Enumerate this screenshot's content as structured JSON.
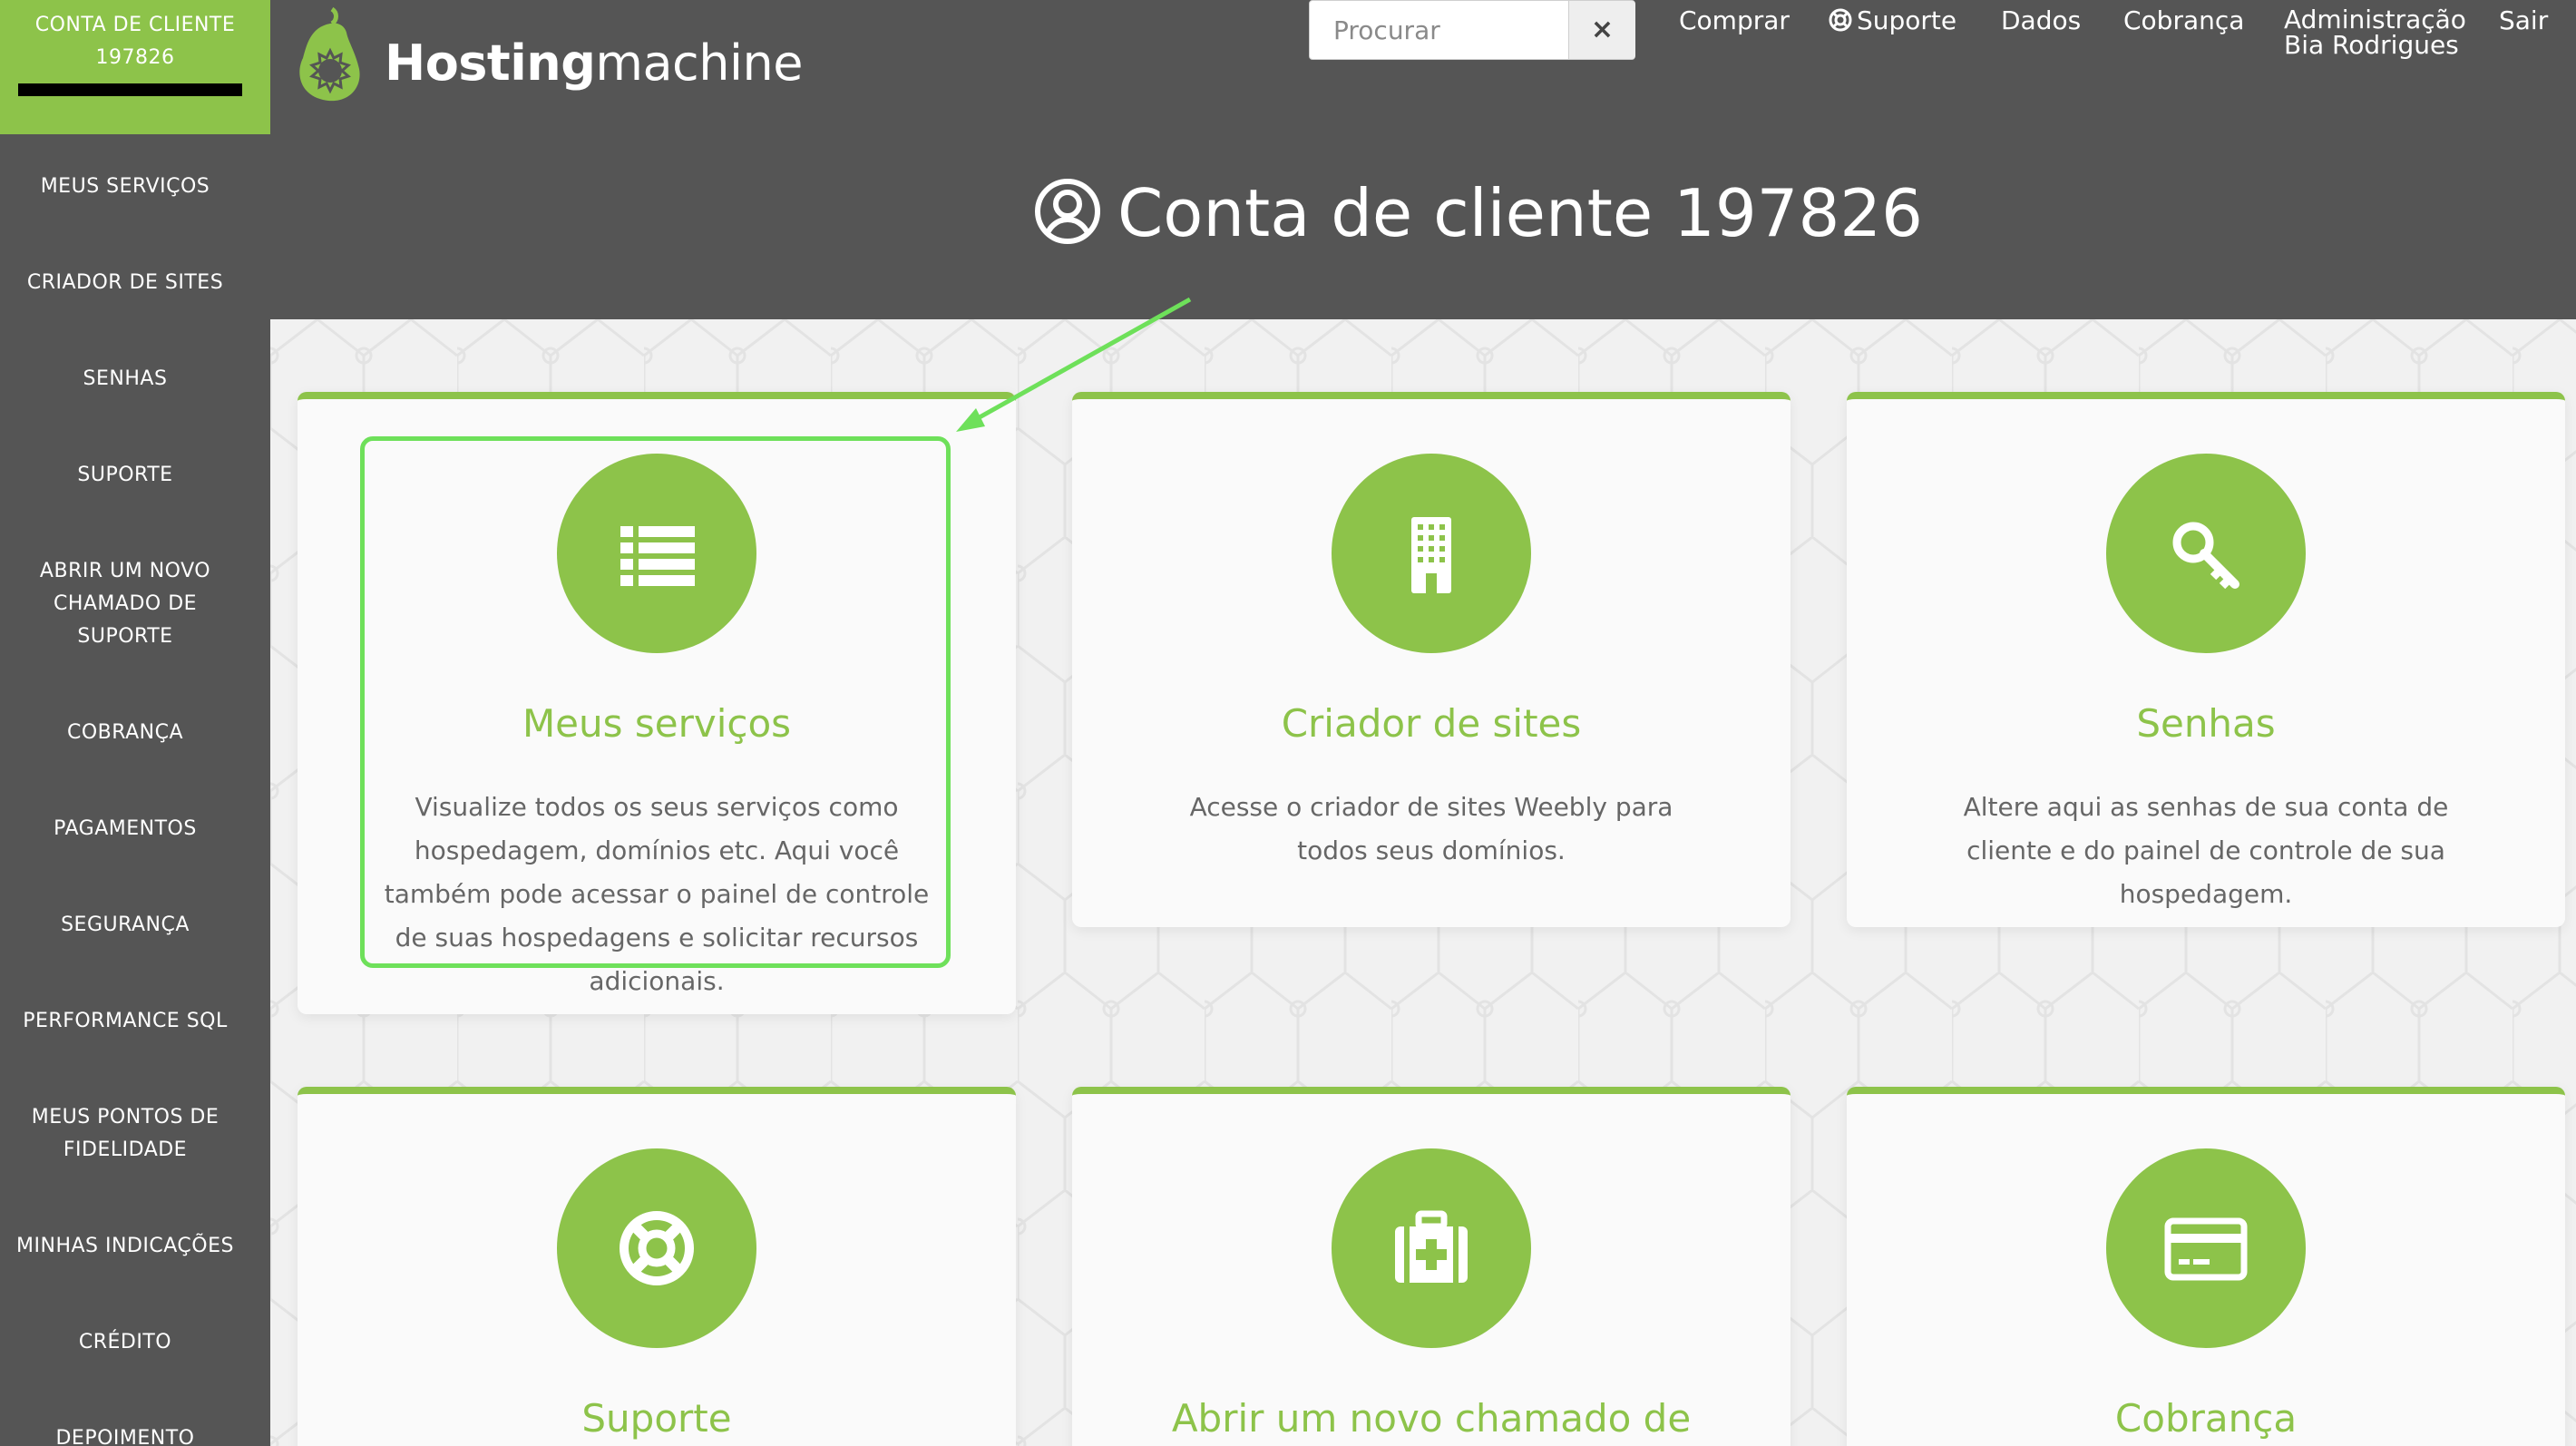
{
  "sidebar": {
    "account_line1": "CONTA DE CLIENTE",
    "account_line2": "197826",
    "items": [
      {
        "line1": "MEUS SERVIÇOS"
      },
      {
        "line1": "CRIADOR DE SITES"
      },
      {
        "line1": "SENHAS"
      },
      {
        "line1": "SUPORTE"
      },
      {
        "line1": "ABRIR UM NOVO",
        "line2": "CHAMADO DE",
        "line3": "SUPORTE"
      },
      {
        "line1": "COBRANÇA"
      },
      {
        "line1": "PAGAMENTOS"
      },
      {
        "line1": "SEGURANÇA"
      },
      {
        "line1": "PERFORMANCE SQL"
      },
      {
        "line1": "MEUS PONTOS DE",
        "line2": "FIDELIDADE"
      },
      {
        "line1": "MINHAS INDICAÇÕES"
      },
      {
        "line1": "CRÉDITO"
      },
      {
        "line1": "DEPOIMENTO"
      }
    ]
  },
  "header": {
    "logo_bold": "Hosting",
    "logo_light": "machine",
    "search_placeholder": "Procurar",
    "search_clear": "×",
    "nav": {
      "buy": "Comprar",
      "support": "Suporte",
      "data": "Dados",
      "billing": "Cobrança",
      "admin": "Administração",
      "admin_user": "Bia Rodrigues",
      "logout": "Sair"
    },
    "page_title": "Conta de cliente 197826"
  },
  "cards": [
    {
      "icon": "list-icon",
      "title": "Meus serviços",
      "description": "Visualize todos os seus serviços como hospedagem, domínios etc. Aqui você também pode acessar o painel de controle de suas hospedagens e solicitar recursos adicionais."
    },
    {
      "icon": "building-icon",
      "title": "Criador de sites",
      "description": "Acesse o criador de sites Weebly para todos seus domínios."
    },
    {
      "icon": "key-icon",
      "title": "Senhas",
      "description": "Altere aqui as senhas de sua conta de cliente e do painel de controle de sua hospedagem."
    },
    {
      "icon": "lifebuoy-icon",
      "title": "Suporte",
      "description": ""
    },
    {
      "icon": "medical-kit-icon",
      "title": "Abrir um novo chamado de",
      "description": ""
    },
    {
      "icon": "credit-card-icon",
      "title": "Cobrança",
      "description": ""
    }
  ],
  "colors": {
    "accent": "#8dc34a",
    "header_bg": "#555555",
    "highlight": "#6ee05a"
  }
}
